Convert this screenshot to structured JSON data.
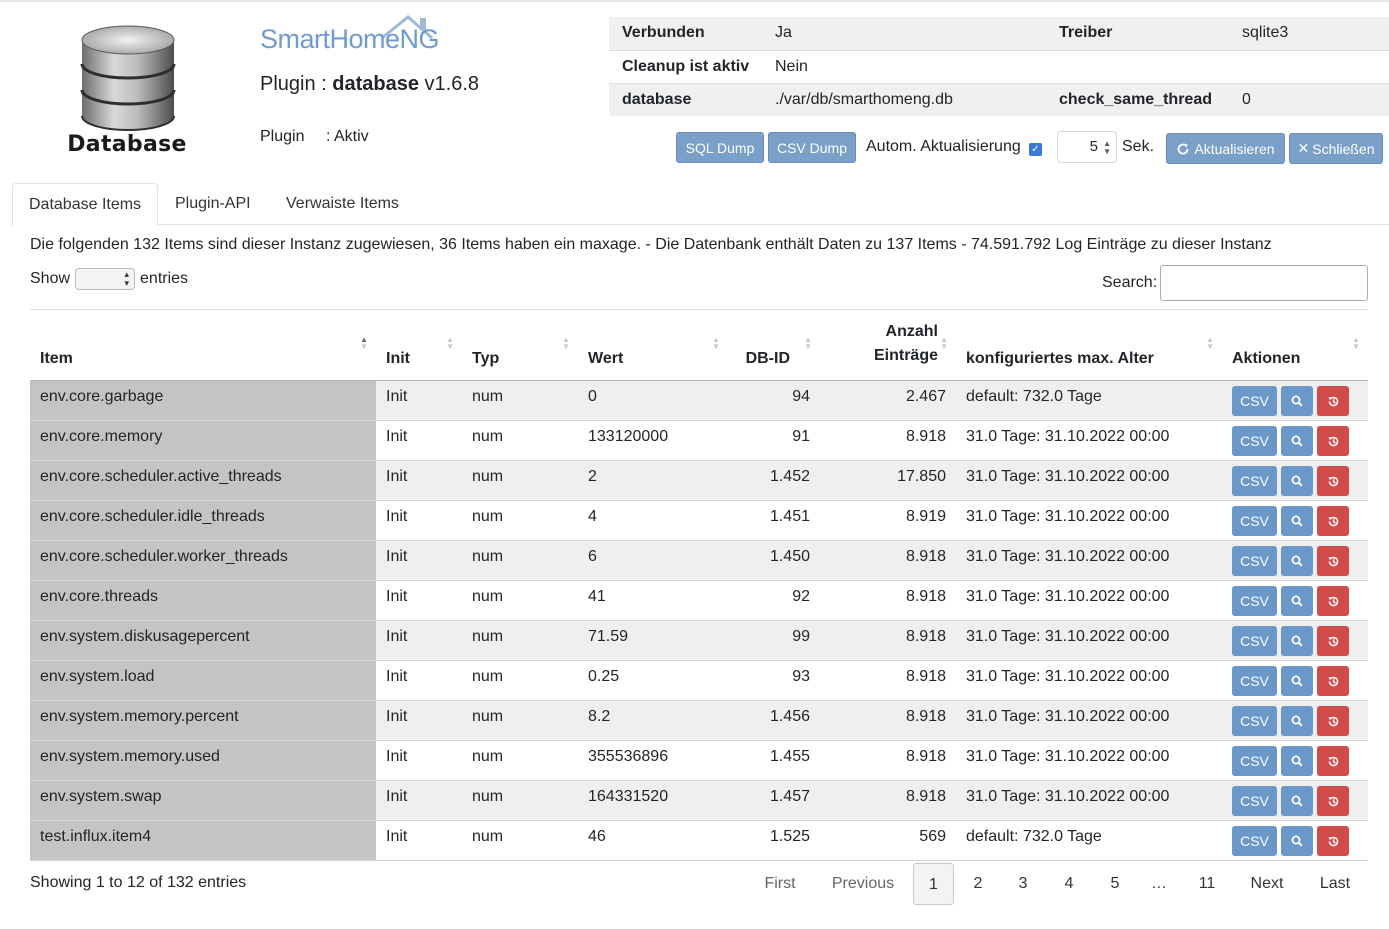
{
  "header": {
    "logo_text": "Database",
    "brand_main": "SmartHome",
    "brand_suffix": "NG",
    "plugin_label": "Plugin : ",
    "plugin_name": "database",
    "plugin_version": " v1.6.8",
    "status_label": "Plugin",
    "status_value": ": Aktiv"
  },
  "info": {
    "rows": [
      {
        "k1": "Verbunden",
        "v1": "Ja",
        "k2": "Treiber",
        "v2": "sqlite3"
      },
      {
        "k1": "Cleanup ist aktiv",
        "v1": "Nein",
        "k2": "",
        "v2": ""
      },
      {
        "k1": "database",
        "v1": "./var/db/smarthomeng.db",
        "k2": "check_same_thread",
        "v2": "0"
      }
    ]
  },
  "toolbar": {
    "sql_dump": "SQL Dump",
    "csv_dump": "CSV Dump",
    "auto_refresh_label": "Autom. Aktualisierung",
    "auto_refresh_checked": true,
    "interval": "5",
    "interval_unit": "Sek.",
    "refresh": "Aktualisieren",
    "close": "Schließen",
    "accent": "#7a9fc9"
  },
  "tabs": [
    "Database Items",
    "Plugin-API",
    "Verwaiste Items"
  ],
  "summary": "Die folgenden 132 Items sind dieser Instanz zugewiesen, 36 Items haben ein maxage. - Die Datenbank enthält Daten zu 137 Items - 74.591.792 Log Einträge zu dieser Instanz",
  "table_controls": {
    "show": "Show",
    "entries": "entries",
    "search_label": "Search:",
    "search_value": ""
  },
  "columns": [
    "Item",
    "Init",
    "Typ",
    "Wert",
    "DB-ID",
    "Anzahl\nEinträge",
    "konfiguriertes max. Alter",
    "Aktionen"
  ],
  "rows": [
    {
      "item": "env.core.garbage",
      "init": "Init",
      "typ": "num",
      "wert": "0",
      "dbid": "94",
      "count": "2.467",
      "maxage": "default: 732.0 Tage"
    },
    {
      "item": "env.core.memory",
      "init": "Init",
      "typ": "num",
      "wert": "133120000",
      "dbid": "91",
      "count": "8.918",
      "maxage": "31.0 Tage: 31.10.2022 00:00"
    },
    {
      "item": "env.core.scheduler.active_threads",
      "init": "Init",
      "typ": "num",
      "wert": "2",
      "dbid": "1.452",
      "count": "17.850",
      "maxage": "31.0 Tage: 31.10.2022 00:00"
    },
    {
      "item": "env.core.scheduler.idle_threads",
      "init": "Init",
      "typ": "num",
      "wert": "4",
      "dbid": "1.451",
      "count": "8.919",
      "maxage": "31.0 Tage: 31.10.2022 00:00"
    },
    {
      "item": "env.core.scheduler.worker_threads",
      "init": "Init",
      "typ": "num",
      "wert": "6",
      "dbid": "1.450",
      "count": "8.918",
      "maxage": "31.0 Tage: 31.10.2022 00:00"
    },
    {
      "item": "env.core.threads",
      "init": "Init",
      "typ": "num",
      "wert": "41",
      "dbid": "92",
      "count": "8.918",
      "maxage": "31.0 Tage: 31.10.2022 00:00"
    },
    {
      "item": "env.system.diskusagepercent",
      "init": "Init",
      "typ": "num",
      "wert": "71.59",
      "dbid": "99",
      "count": "8.918",
      "maxage": "31.0 Tage: 31.10.2022 00:00"
    },
    {
      "item": "env.system.load",
      "init": "Init",
      "typ": "num",
      "wert": "0.25",
      "dbid": "93",
      "count": "8.918",
      "maxage": "31.0 Tage: 31.10.2022 00:00"
    },
    {
      "item": "env.system.memory.percent",
      "init": "Init",
      "typ": "num",
      "wert": "8.2",
      "dbid": "1.456",
      "count": "8.918",
      "maxage": "31.0 Tage: 31.10.2022 00:00"
    },
    {
      "item": "env.system.memory.used",
      "init": "Init",
      "typ": "num",
      "wert": "355536896",
      "dbid": "1.455",
      "count": "8.918",
      "maxage": "31.0 Tage: 31.10.2022 00:00"
    },
    {
      "item": "env.system.swap",
      "init": "Init",
      "typ": "num",
      "wert": "164331520",
      "dbid": "1.457",
      "count": "8.918",
      "maxage": "31.0 Tage: 31.10.2022 00:00"
    },
    {
      "item": "test.influx.item4",
      "init": "Init",
      "typ": "num",
      "wert": "46",
      "dbid": "1.525",
      "count": "569",
      "maxage": "default: 732.0 Tage"
    }
  ],
  "row_actions": {
    "csv": "CSV",
    "search_icon": "search-icon",
    "delete_icon": "history-icon"
  },
  "footer": {
    "showing": "Showing 1 to 12 of 132 entries",
    "first": "First",
    "previous": "Previous",
    "pages": [
      "1",
      "2",
      "3",
      "4",
      "5",
      "…",
      "11"
    ],
    "current_page": "1",
    "next": "Next",
    "last": "Last"
  }
}
